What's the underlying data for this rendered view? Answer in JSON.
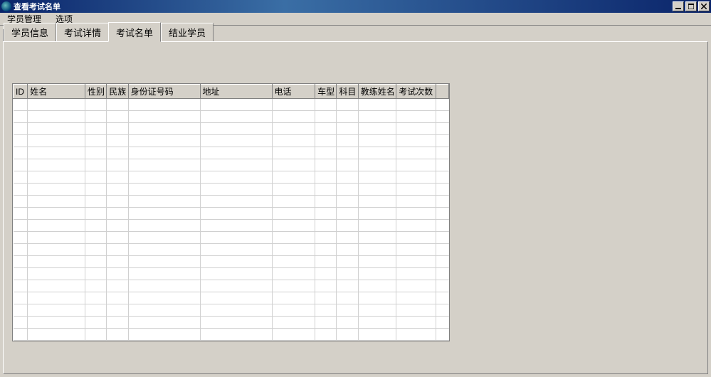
{
  "window": {
    "title": "查看考试名单"
  },
  "menu": {
    "student_mgmt": "学员管理",
    "options": "选项"
  },
  "tabs": {
    "student_info": "学员信息",
    "exam_detail": "考试详情",
    "exam_list": "考试名单",
    "grad_student": "结业学员"
  },
  "columns": {
    "id": "ID",
    "name": "姓名",
    "sex": "性别",
    "ethnicity": "民族",
    "id_number": "身份证号码",
    "address": "地址",
    "phone": "电话",
    "car_type": "车型",
    "subject": "科目",
    "coach_name": "教练姓名",
    "exam_count": "考试次数"
  },
  "rows": []
}
